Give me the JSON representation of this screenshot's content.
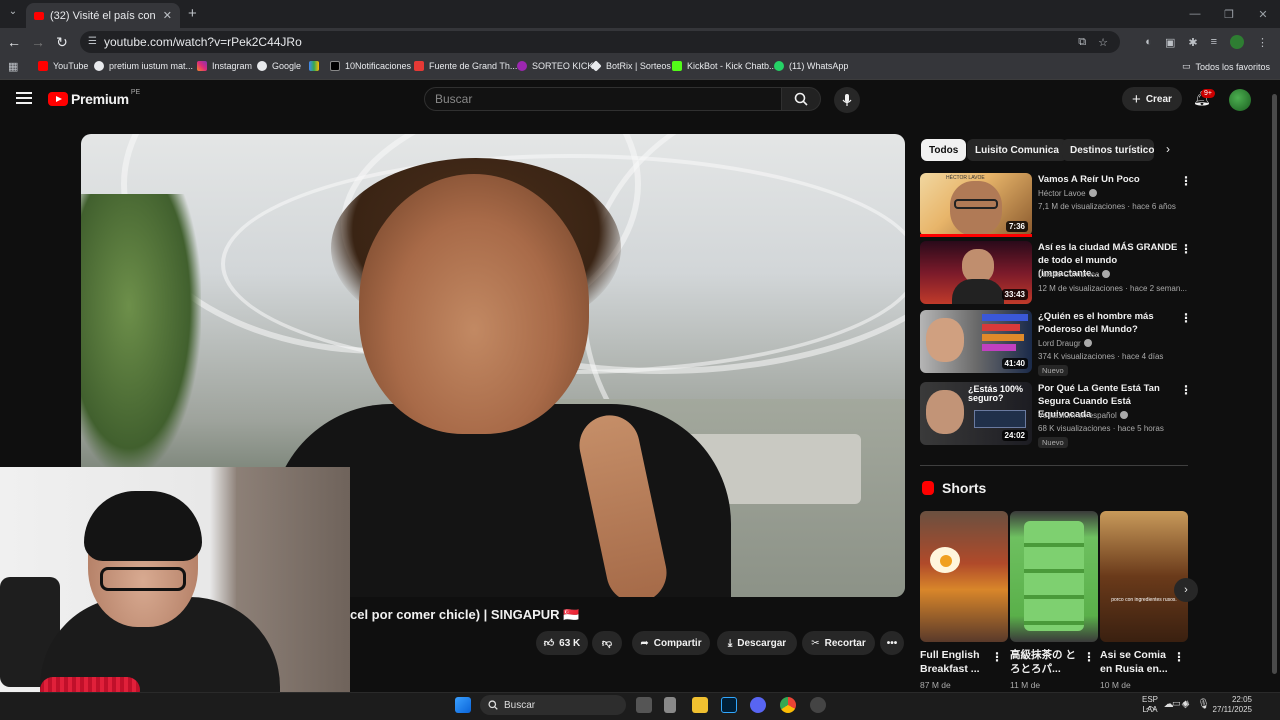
{
  "browser": {
    "tab_title": "(32) Visité el país con las leyes",
    "url": "youtube.com/watch?v=rPek2C44JRo",
    "bookmarks": [
      "YouTube",
      "pretium iustum mat...",
      "Instagram",
      "Google",
      "10Notificaciones",
      "Fuente de Grand Th...",
      "SORTEO KICK",
      "BotRix | Sorteos",
      "KickBot - Kick Chatb...",
      "(11) WhatsApp"
    ],
    "all_bookmarks": "Todos los favoritos"
  },
  "youtube": {
    "logo_text": "Premium",
    "country": "PE",
    "search_placeholder": "Buscar",
    "create_label": "Crear",
    "notif_count": "9+"
  },
  "video": {
    "title_visible": "cel por comer chicle) | SINGAPUR 🇸🇬",
    "likes": "63 K",
    "share": "Compartir",
    "download": "Descargar",
    "clip": "Recortar"
  },
  "chips": [
    "Todos",
    "Luisito Comunica",
    "Destinos turísticos"
  ],
  "recommendations": [
    {
      "title": "Vamos A Reír Un Poco",
      "channel": "Héctor Lavoe",
      "verified": true,
      "meta": "7,1 M de visualizaciones · hace 6 años",
      "duration": "7:36",
      "new": ""
    },
    {
      "title": "Así es la ciudad MÁS GRANDE de todo el mundo (impactante...",
      "channel": "Luisito Comunica",
      "verified": true,
      "meta": "12 M de visualizaciones · hace 2 seman...",
      "duration": "33:43",
      "new": ""
    },
    {
      "title": "¿Quién es el hombre más Poderoso del Mundo?",
      "channel": "Lord Draugr",
      "verified": true,
      "meta": "374 K visualizaciones · hace 4 días",
      "duration": "41:40",
      "new": "Nuevo"
    },
    {
      "title": "Por Qué La Gente Está Tan Segura Cuando Está Equivocada",
      "channel": "Veritasium en español",
      "verified": true,
      "meta": "68 K visualizaciones · hace 5 horas",
      "duration": "24:02",
      "new": "Nuevo"
    }
  ],
  "thumb_text": {
    "lavoe_caption": "HÉCTOR LAVOE",
    "veritasium": "¿Estás 100% seguro?"
  },
  "shorts": {
    "heading": "Shorts",
    "items": [
      {
        "title": "Full English Breakfast ...",
        "views": "87 M de"
      },
      {
        "title": "高級抹茶の とろとろパ...",
        "views": "11 M de"
      },
      {
        "title": "Asi se Comia en Rusia en...",
        "views": "10 M de"
      }
    ],
    "caption3": "porco con ingredientes rusos."
  },
  "taskbar": {
    "search": "Buscar",
    "lang1": "ESP",
    "lang2": "LAA",
    "time": "22:05",
    "date": "27/11/2025"
  }
}
